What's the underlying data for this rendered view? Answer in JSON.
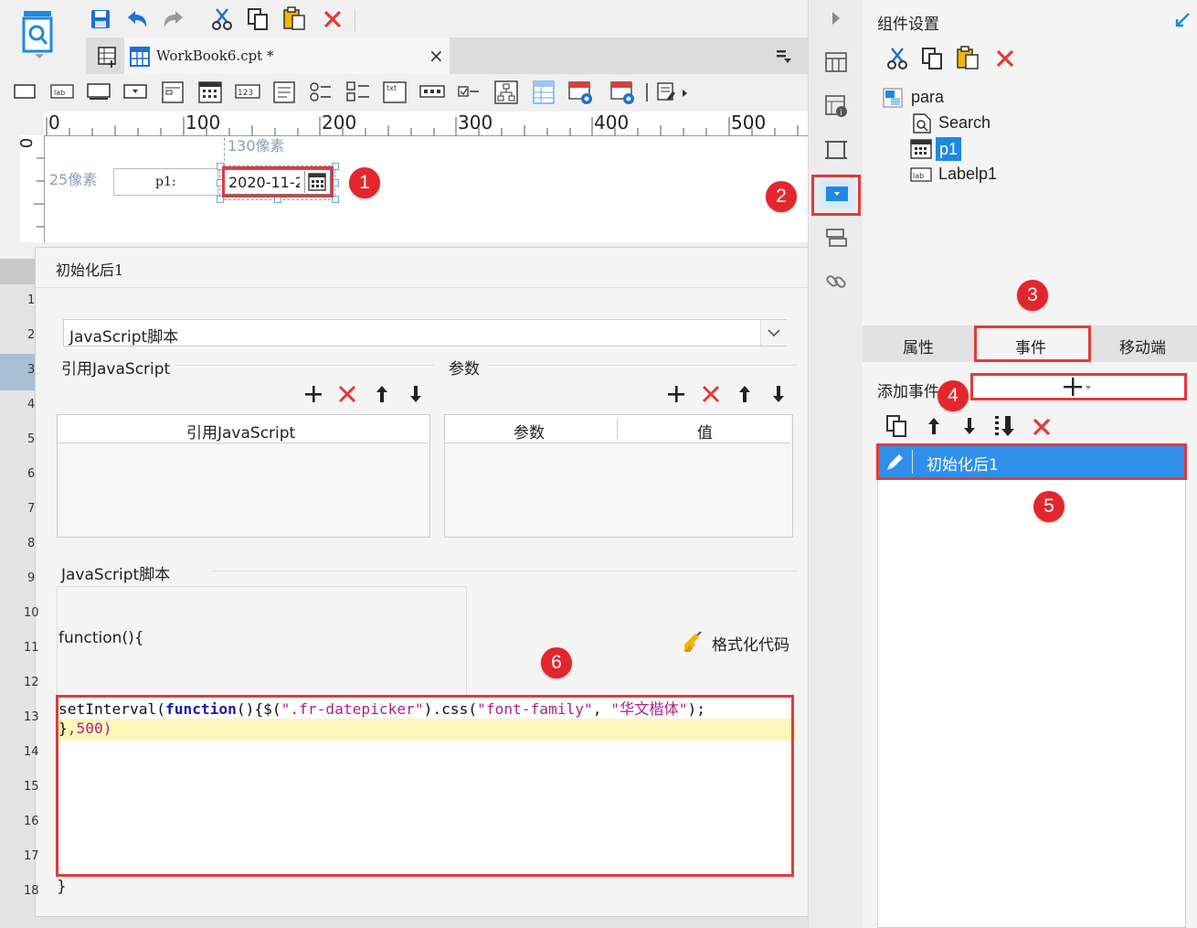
{
  "toolbar": {
    "tab_title": "WorkBook6.cpt *",
    "tab_close": "×"
  },
  "ruler": {
    "ticks": [
      "0",
      "100",
      "200",
      "300",
      "400",
      "500"
    ],
    "vertical_zero": "0"
  },
  "canvas": {
    "width_hint": "130像素",
    "height_hint": "25像素",
    "label_text": "p1:",
    "date_value": "2020-11-2"
  },
  "row_numbers": [
    "1",
    "2",
    "3",
    "4",
    "5",
    "6",
    "7",
    "8",
    "9",
    "10",
    "11",
    "12",
    "13",
    "14",
    "15",
    "16",
    "17",
    "18"
  ],
  "editor": {
    "title": "初始化后1",
    "type_select": "JavaScript脚本",
    "ref_js_section": "引用JavaScript",
    "params_section": "参数",
    "ref_js_header": "引用JavaScript",
    "param_header": "参数",
    "value_header": "值",
    "script_section": "JavaScript脚本",
    "func_open": "function(){",
    "format_code": "格式化代码",
    "code_line1": {
      "p1": "setInterval(",
      "kw": "function",
      "p2": "(){$(",
      "s1": "\".fr-datepicker\"",
      "p3": ").css(",
      "s2": "\"font-family\"",
      "p4": ", ",
      "s3": "\"华文楷体\"",
      "p5": ");"
    },
    "code_line2": {
      "p1": "}",
      "num": ",500)"
    },
    "func_close": "}"
  },
  "right_panel": {
    "title": "组件设置",
    "tree": {
      "root": "para",
      "child1": "Search",
      "child2": "p1",
      "child3": "Labelp1"
    },
    "tabs": {
      "attr": "属性",
      "event": "事件",
      "mobile": "移动端"
    },
    "add_event_label": "添加事件",
    "event_item": "初始化后1"
  },
  "badges": [
    "1",
    "2",
    "3",
    "4",
    "5",
    "6"
  ],
  "colors": {
    "accent": "#1e88e5",
    "red": "#e23a3a",
    "badge": "#e3262d",
    "highlight_line": "#fbf7b8"
  }
}
